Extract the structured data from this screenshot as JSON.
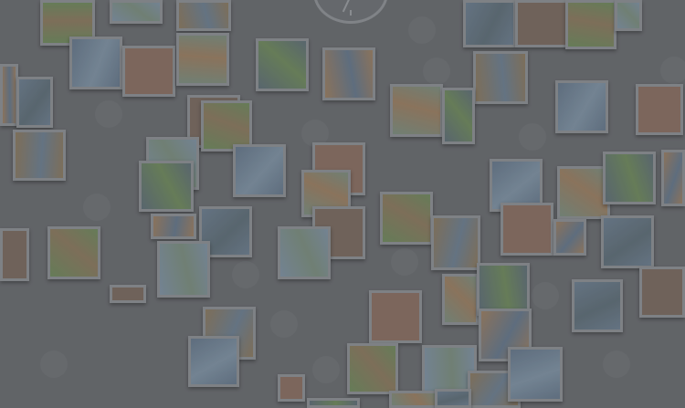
{
  "wall": {
    "background": "#6a6d70",
    "photo_count": 60,
    "thumbnail_palette": [
      "#6f8a5d",
      "#7f93a4",
      "#8b7a5f",
      "#66788b",
      "#8a6f62",
      "#7c8e7f",
      "#5f6f78",
      "#9b7f62",
      "#6d7f90",
      "#7a6b60"
    ]
  },
  "clock": {
    "icon": "clock-icon"
  }
}
